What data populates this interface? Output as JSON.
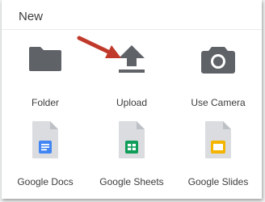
{
  "menu": {
    "title": "New",
    "items": [
      {
        "label": "Folder",
        "icon": "folder-icon"
      },
      {
        "label": "Upload",
        "icon": "upload-icon"
      },
      {
        "label": "Use Camera",
        "icon": "camera-icon"
      },
      {
        "label": "Google Docs",
        "icon": "google-docs-icon"
      },
      {
        "label": "Google Sheets",
        "icon": "google-sheets-icon"
      },
      {
        "label": "Google Slides",
        "icon": "google-slides-icon"
      }
    ]
  },
  "colors": {
    "icon_gray": "#5f6368",
    "docs_blue": "#4285f4",
    "sheets_green": "#0f9d58",
    "slides_yellow": "#f4b400",
    "annotation_arrow": "#c0392b"
  }
}
